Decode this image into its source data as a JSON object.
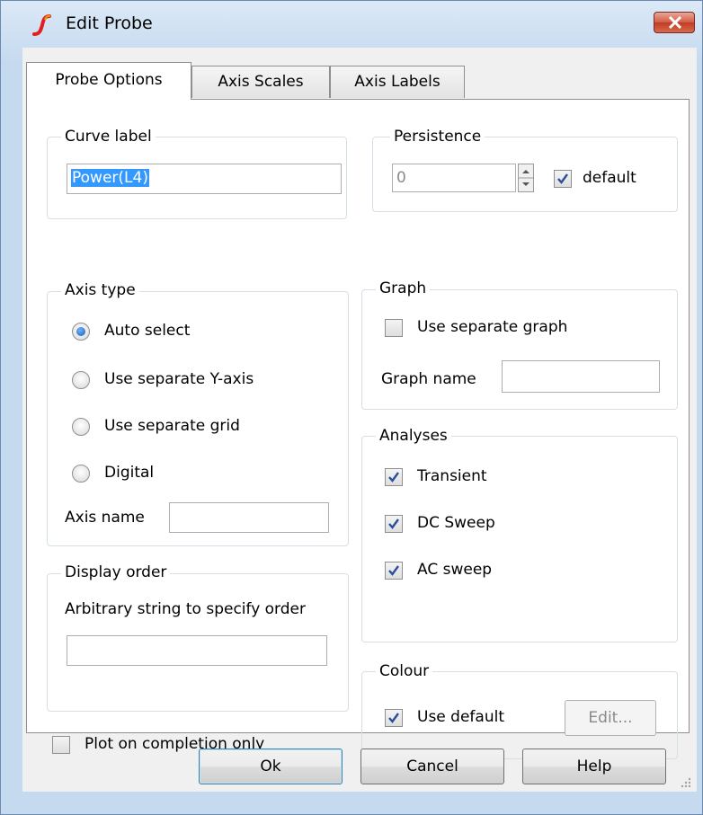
{
  "window": {
    "title": "Edit Probe",
    "close_glyph": "close-icon"
  },
  "tabs": [
    {
      "label": "Probe Options",
      "active": true
    },
    {
      "label": "Axis Scales",
      "active": false
    },
    {
      "label": "Axis Labels",
      "active": false
    }
  ],
  "curve_label": {
    "group": "Curve label",
    "value": "Power(L4)"
  },
  "persistence": {
    "group": "Persistence",
    "value": "0",
    "default_label": "default",
    "default_checked": true
  },
  "axis_type": {
    "group": "Axis type",
    "options": [
      {
        "label": "Auto select",
        "selected": true
      },
      {
        "label": "Use separate Y-axis",
        "selected": false
      },
      {
        "label": "Use separate grid",
        "selected": false
      },
      {
        "label": "Digital",
        "selected": false
      }
    ],
    "axis_name_label": "Axis name",
    "axis_name_value": ""
  },
  "graph": {
    "group": "Graph",
    "separate_label": "Use separate graph",
    "separate_checked": false,
    "graph_name_label": "Graph name",
    "graph_name_value": ""
  },
  "analyses": {
    "group": "Analyses",
    "items": [
      {
        "label": "Transient",
        "checked": true
      },
      {
        "label": "DC Sweep",
        "checked": true
      },
      {
        "label": "AC sweep",
        "checked": true
      }
    ]
  },
  "display_order": {
    "group": "Display order",
    "description": "Arbitrary string to specify order",
    "value": ""
  },
  "colour": {
    "group": "Colour",
    "use_default_label": "Use default",
    "use_default_checked": true,
    "edit_label": "Edit..."
  },
  "plot_on_completion": {
    "label": "Plot on completion only",
    "checked": false
  },
  "buttons": {
    "ok": "Ok",
    "cancel": "Cancel",
    "help": "Help"
  },
  "colors": {
    "selection": "#3399ff",
    "title_bg": "#c5d9ef",
    "close": "#c94a30"
  }
}
